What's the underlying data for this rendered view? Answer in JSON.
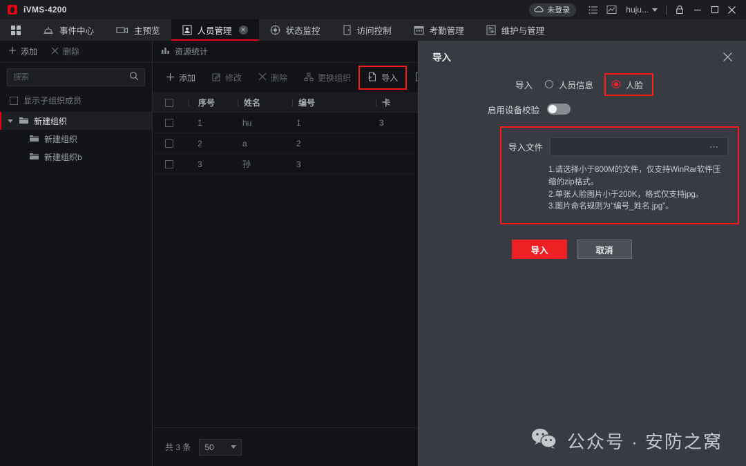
{
  "titlebar": {
    "app_title": "iVMS-4200",
    "logo_icon": "hik-logo-icon",
    "login_status": "未登录",
    "cloud_icon": "cloud-icon",
    "list_icon": "list-icon",
    "chart_icon": "chart-icon",
    "user_name": "huju...",
    "lock_icon": "lock-icon",
    "minimize_icon": "minimize-icon",
    "maximize_icon": "maximize-icon",
    "close_icon": "close-icon"
  },
  "navbar": {
    "grid_icon": "grid-menu-icon",
    "tabs": [
      {
        "label": "事件中心",
        "icon": "alarm-bell-icon",
        "active": false
      },
      {
        "label": "主预览",
        "icon": "video-camera-icon",
        "active": false
      },
      {
        "label": "人员管理",
        "icon": "person-card-icon",
        "active": true,
        "closable": true
      },
      {
        "label": "状态监控",
        "icon": "target-monitor-icon",
        "active": false
      },
      {
        "label": "访问控制",
        "icon": "door-access-icon",
        "active": false
      },
      {
        "label": "考勤管理",
        "icon": "calendar-icon",
        "active": false
      },
      {
        "label": "维护与管理",
        "icon": "maintenance-icon",
        "active": false
      }
    ]
  },
  "left_panel": {
    "add_label": "添加",
    "delete_label": "删除",
    "add_icon": "plus-icon",
    "delete_icon": "cross-icon",
    "search_placeholder": "搜索",
    "search_value": "",
    "search_icon": "search-icon",
    "show_sub_label": "显示子组织成员",
    "show_sub_checked": false,
    "tree": [
      {
        "label": "新建组织",
        "level": 0,
        "selected": true,
        "expanded": true,
        "icon": "folder-icon"
      },
      {
        "label": "新建组织",
        "level": 1,
        "selected": false,
        "icon": "folder-icon"
      },
      {
        "label": "新建组织b",
        "level": 1,
        "selected": false,
        "icon": "folder-icon"
      }
    ]
  },
  "main_panel": {
    "header_label": "资源统计",
    "header_icon": "bar-chart-icon",
    "toolbar": [
      {
        "label": "添加",
        "icon": "plus-icon",
        "enabled": true,
        "highlighted": false
      },
      {
        "label": "修改",
        "icon": "edit-icon",
        "enabled": false,
        "highlighted": false
      },
      {
        "label": "删除",
        "icon": "cross-icon",
        "enabled": false,
        "highlighted": false
      },
      {
        "label": "更换组织",
        "icon": "org-switch-icon",
        "enabled": false,
        "highlighted": false
      },
      {
        "label": "导入",
        "icon": "import-icon",
        "enabled": true,
        "highlighted": true
      },
      {
        "label": "",
        "icon": "export-icon",
        "enabled": true,
        "highlighted": false
      }
    ],
    "table": {
      "headers": [
        "序号",
        "姓名",
        "编号",
        "卡"
      ],
      "header_checkbox": false,
      "rows": [
        {
          "checked": false,
          "index": "1",
          "name": "hu",
          "number": "1",
          "card": "3"
        },
        {
          "checked": false,
          "index": "2",
          "name": "a",
          "number": "2",
          "card": ""
        },
        {
          "checked": false,
          "index": "3",
          "name": "孙",
          "number": "3",
          "card": ""
        }
      ]
    },
    "footer": {
      "total_label": "共 3 条",
      "page_size": "50"
    }
  },
  "dialog": {
    "title": "导入",
    "close_icon": "close-icon",
    "import_label": "导入",
    "options": [
      {
        "label": "人员信息",
        "selected": false,
        "highlighted": false
      },
      {
        "label": "人脸",
        "selected": true,
        "highlighted": true
      }
    ],
    "verify_label": "启用设备校验",
    "verify_on": false,
    "file_label": "导入文件",
    "file_value": "",
    "file_browse_icon": "ellipsis-icon",
    "notes": [
      "1.请选择小于800M的文件，仅支持WinRar软件压缩的zip格式。",
      "2.单张人脸图片小于200K，格式仅支持jpg。",
      "3.图片命名规则为\"编号_姓名.jpg\"。"
    ],
    "confirm_label": "导入",
    "cancel_label": "取消"
  },
  "watermark": {
    "icon": "wechat-icon",
    "text": "公众号 · 安防之窝"
  },
  "colors": {
    "accent_red": "#e60012",
    "highlight_red": "#ff1a1a",
    "primary_button": "#ed2024",
    "dialog_bg": "#383c42",
    "main_bg": "#121316",
    "titlebar_bg": "#1b1d20",
    "navbar_bg": "#232529"
  }
}
